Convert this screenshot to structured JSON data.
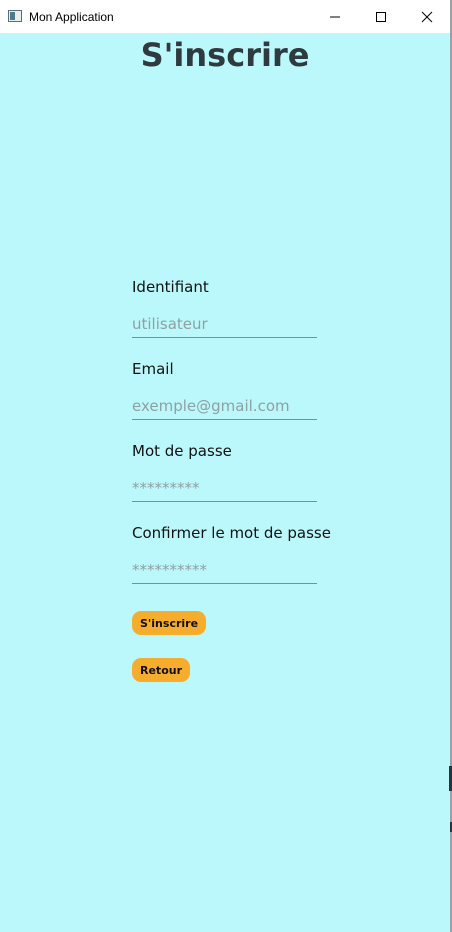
{
  "window": {
    "title": "Mon Application",
    "icon": "app-window-icon",
    "controls": [
      "minimize-icon",
      "maximize-icon",
      "close-icon"
    ]
  },
  "page": {
    "title": "S'inscrire"
  },
  "form": {
    "username": {
      "label": "Identifiant",
      "placeholder": "utilisateur",
      "value": ""
    },
    "email": {
      "label": "Email",
      "placeholder": "exemple@gmail.com",
      "value": ""
    },
    "password": {
      "label": "Mot de passe",
      "placeholder": "*********",
      "value": ""
    },
    "confirm_password": {
      "label": "Confirmer le mot de passe",
      "placeholder": "**********",
      "value": ""
    }
  },
  "buttons": {
    "register": "S'inscrire",
    "back": "Retour"
  },
  "colors": {
    "background": "#bbf8fb",
    "button": "#f6ad2d",
    "title": "#2e3a3d"
  }
}
